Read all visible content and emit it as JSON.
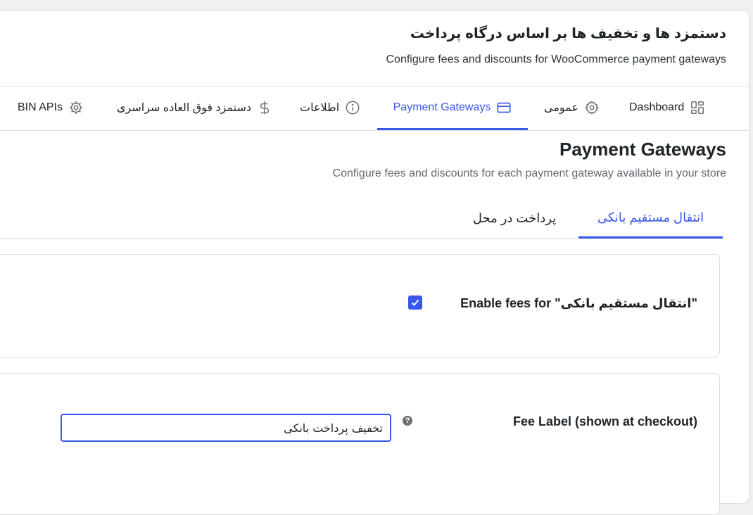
{
  "header": {
    "title": "دستمزد ها و تخفیف ها بر اساس درگاه پرداخت",
    "subtitle": "Configure fees and discounts for WooCommerce payment gateways"
  },
  "tabs": [
    {
      "label": "Dashboard",
      "icon": "grid-icon"
    },
    {
      "label": "عمومی",
      "icon": "gear-icon"
    },
    {
      "label": "Payment Gateways",
      "icon": "credit-card-icon",
      "active": true
    },
    {
      "label": "اطلاعات",
      "icon": "info-icon"
    },
    {
      "label": "دستمزد فوق العاده سراسری",
      "icon": "dollar-icon"
    },
    {
      "label": "BIN APIs",
      "icon": "cog-icon"
    }
  ],
  "section": {
    "title": "Payment Gateways",
    "subtitle": "Configure fees and discounts for each payment gateway available in your store"
  },
  "gateway_tabs": [
    {
      "label": "انتقال مستقیم بانکی",
      "active": true
    },
    {
      "label": "پرداخت در محل",
      "active": false
    }
  ],
  "enable_fees": {
    "label": "Enable fees for \"انتقال مستقیم بانکی\"",
    "checked": true
  },
  "fee_label": {
    "label": "Fee Label (shown at checkout)",
    "help": "?",
    "value": "تخفیف پرداخت بانکی"
  },
  "colors": {
    "accent": "#3858e9",
    "text": "#1d2327",
    "muted": "#646970",
    "border": "#dcdcde"
  }
}
